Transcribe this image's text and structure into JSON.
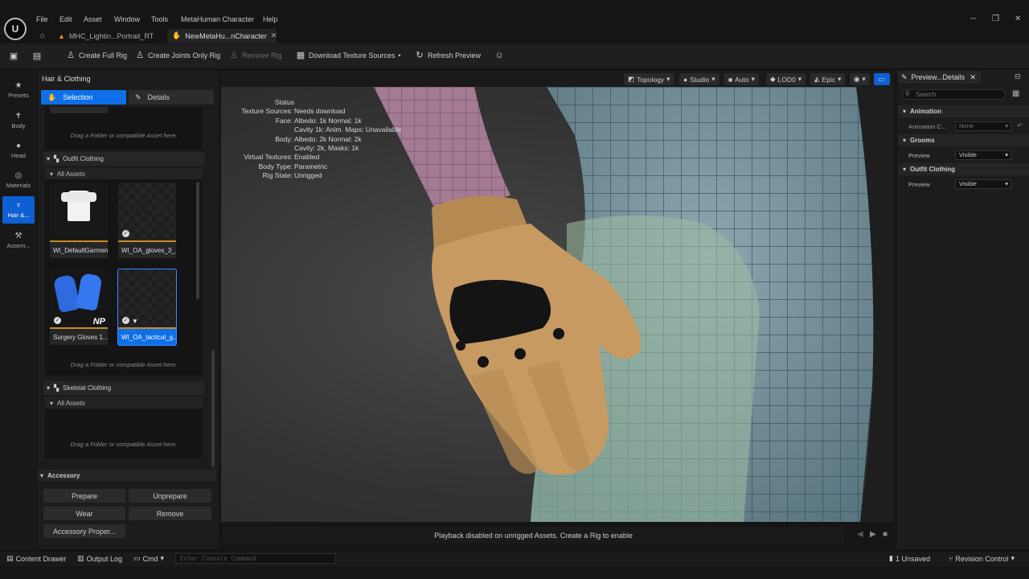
{
  "menu": [
    "File",
    "Edit",
    "Asset",
    "Window",
    "Tools",
    "MetaHuman Character",
    "Help"
  ],
  "tabs": [
    {
      "label": "MHC_Lightin...Portrait_RT"
    },
    {
      "label": "NewMetaHu...nCharacter"
    }
  ],
  "window_controls": {
    "minimize": "─",
    "maximize": "❐",
    "close": "✕"
  },
  "toolbar": {
    "create_full_rig": "Create Full Rig",
    "create_joints_rig": "Create Joints Only Rig",
    "remove_rig": "Remove Rig",
    "download_texture": "Download Texture Sources",
    "refresh_preview": "Refresh Preview"
  },
  "leftbar": [
    "Presets",
    "Body",
    "Head",
    "Materials",
    "Hair &...",
    "Assem..."
  ],
  "panel": {
    "title": "Hair & Clothing",
    "selection_tab": "Selection",
    "details_tab": "Details",
    "drop_hint": "Drag a Folder or compatible Asset here.",
    "outfit_section": "Outfit Clothing",
    "all_assets": "All Assets",
    "tiles": [
      "WI_DefaultGarment",
      "WI_OA_gloves_3_...",
      "Surgery Gloves 1...",
      "WI_OA_tactical_g..."
    ],
    "np_badge": "NP",
    "skeletal_section": "Skeletal Clothing",
    "accessory_section": "Accessory",
    "buttons": {
      "prepare": "Prepare",
      "unprepare": "Unprepare",
      "wear": "Wear",
      "remove": "Remove",
      "properties": "Accessory Proper..."
    }
  },
  "viewport_toolbar": [
    "Topology",
    "Studio",
    "Auto",
    "LOD0",
    "Epic"
  ],
  "status": {
    "title": "Status",
    "rows": [
      {
        "k": "Texture Sources:",
        "v": "Needs download"
      },
      {
        "k": "Face:",
        "v": "Albedo: 1k Normal: 1k"
      },
      {
        "k": "",
        "v": "Cavity 1k: Anim. Maps: Unavailable"
      },
      {
        "k": "Body:",
        "v": "Albedo: 2k Normal: 2k"
      },
      {
        "k": "",
        "v": "Cavity: 2k, Masks: 1k"
      },
      {
        "k": "Virtual Textures:",
        "v": "Enabled"
      },
      {
        "k": "Body Type:",
        "v": "Parametric"
      },
      {
        "k": "Rig State:",
        "v": "Unrigged"
      }
    ]
  },
  "playback_msg": "Playback disabled on unrigged Assets. Create a Rig to enable",
  "details": {
    "tab": "Preview...Details",
    "search_placeholder": "Search",
    "animation": "Animation",
    "anim_row": "Animation C...",
    "anim_value": "None",
    "grooms": "Grooms",
    "preview": "Preview",
    "visible": "Visible",
    "outfit": "Outfit Clothing"
  },
  "statusbar": {
    "content_drawer": "Content Drawer",
    "output_log": "Output Log",
    "cmd": "Cmd",
    "console_placeholder": "Enter Console Command",
    "unsaved": "1 Unsaved",
    "revision": "Revision Control"
  },
  "colors": {
    "accent": "#0e6fe8",
    "glove": "#c79a62",
    "mesh": "#7f9c8e"
  }
}
